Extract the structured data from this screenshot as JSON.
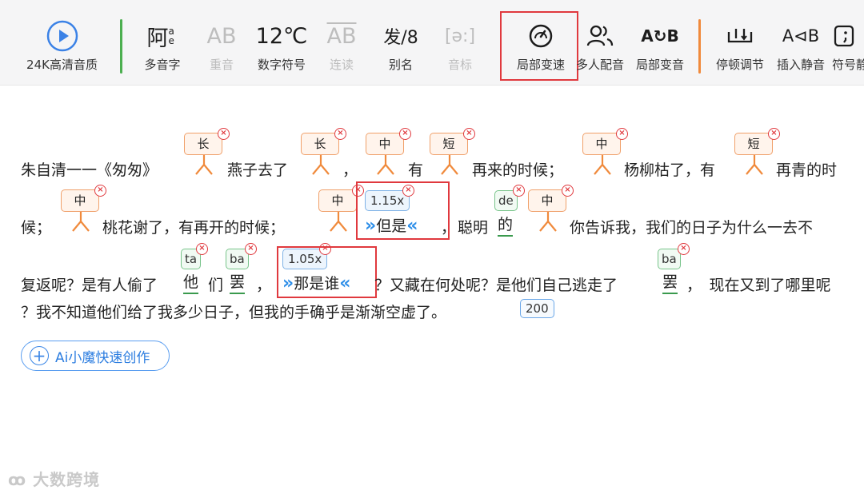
{
  "toolbar": {
    "items": [
      {
        "icon": "play-circle-icon",
        "label": "24K高清音质"
      },
      {
        "icon": "阿",
        "label": "多音字"
      },
      {
        "icon": "AB",
        "label": "重音"
      },
      {
        "icon": "12℃",
        "label": "数字符号"
      },
      {
        "icon": "AB",
        "label": "连读"
      },
      {
        "icon": "发/8",
        "label": "别名"
      },
      {
        "icon": "[ə:]",
        "label": "音标"
      },
      {
        "icon": "speedometer-icon",
        "label": "局部变速"
      },
      {
        "icon": "people-icon",
        "label": "多人配音"
      },
      {
        "icon": "A↻B",
        "label": "局部变音"
      },
      {
        "icon": "pause-adjust-icon",
        "label": "停顿调节"
      },
      {
        "icon": "A⊲B",
        "label": "插入静音"
      },
      {
        "icon": "symbol-icon",
        "label": "符号静"
      }
    ],
    "divider_colors": {
      "green": "#4caf50",
      "orange": "#f08a3c"
    }
  },
  "pause_labels": {
    "long": "长",
    "mid": "中",
    "short": "短"
  },
  "pron": {
    "de": "de",
    "ta": "ta",
    "ba": "ba"
  },
  "speed": {
    "a": "1.15x",
    "b": "1.05x"
  },
  "text": {
    "l1a": "朱自清一一《匆匆》",
    "l1b": "燕子去了",
    "l1c": "，",
    "l1d": "有",
    "l1e": "再来的时候；",
    "l1f": "杨柳枯了，有",
    "l1g": "再青的时",
    "l2a": "候；",
    "l2b": "桃花谢了，有再开的时候；",
    "l2c": "但是",
    "l2d": "，",
    "l2e": "聪明",
    "l2f": "的",
    "l2g": "你告诉我，我们的日子为什么一去不",
    "l3a": "复返呢？是有人偷了",
    "l3b": "他",
    "l3c": "们",
    "l3d": "罢",
    "l3e": "，",
    "l3f": "那是谁",
    "l3g": "？又藏在何处呢？是他们自己逃走了",
    "l3h": "罢",
    "l3i": "，　现在又到了哪里呢",
    "l4a": "？我不知道他们给了我多少日子，但我的手确乎是渐渐空虚了。",
    "count": "200"
  },
  "ai_button": "Ai小魔快速创作",
  "watermark": "大数跨境"
}
